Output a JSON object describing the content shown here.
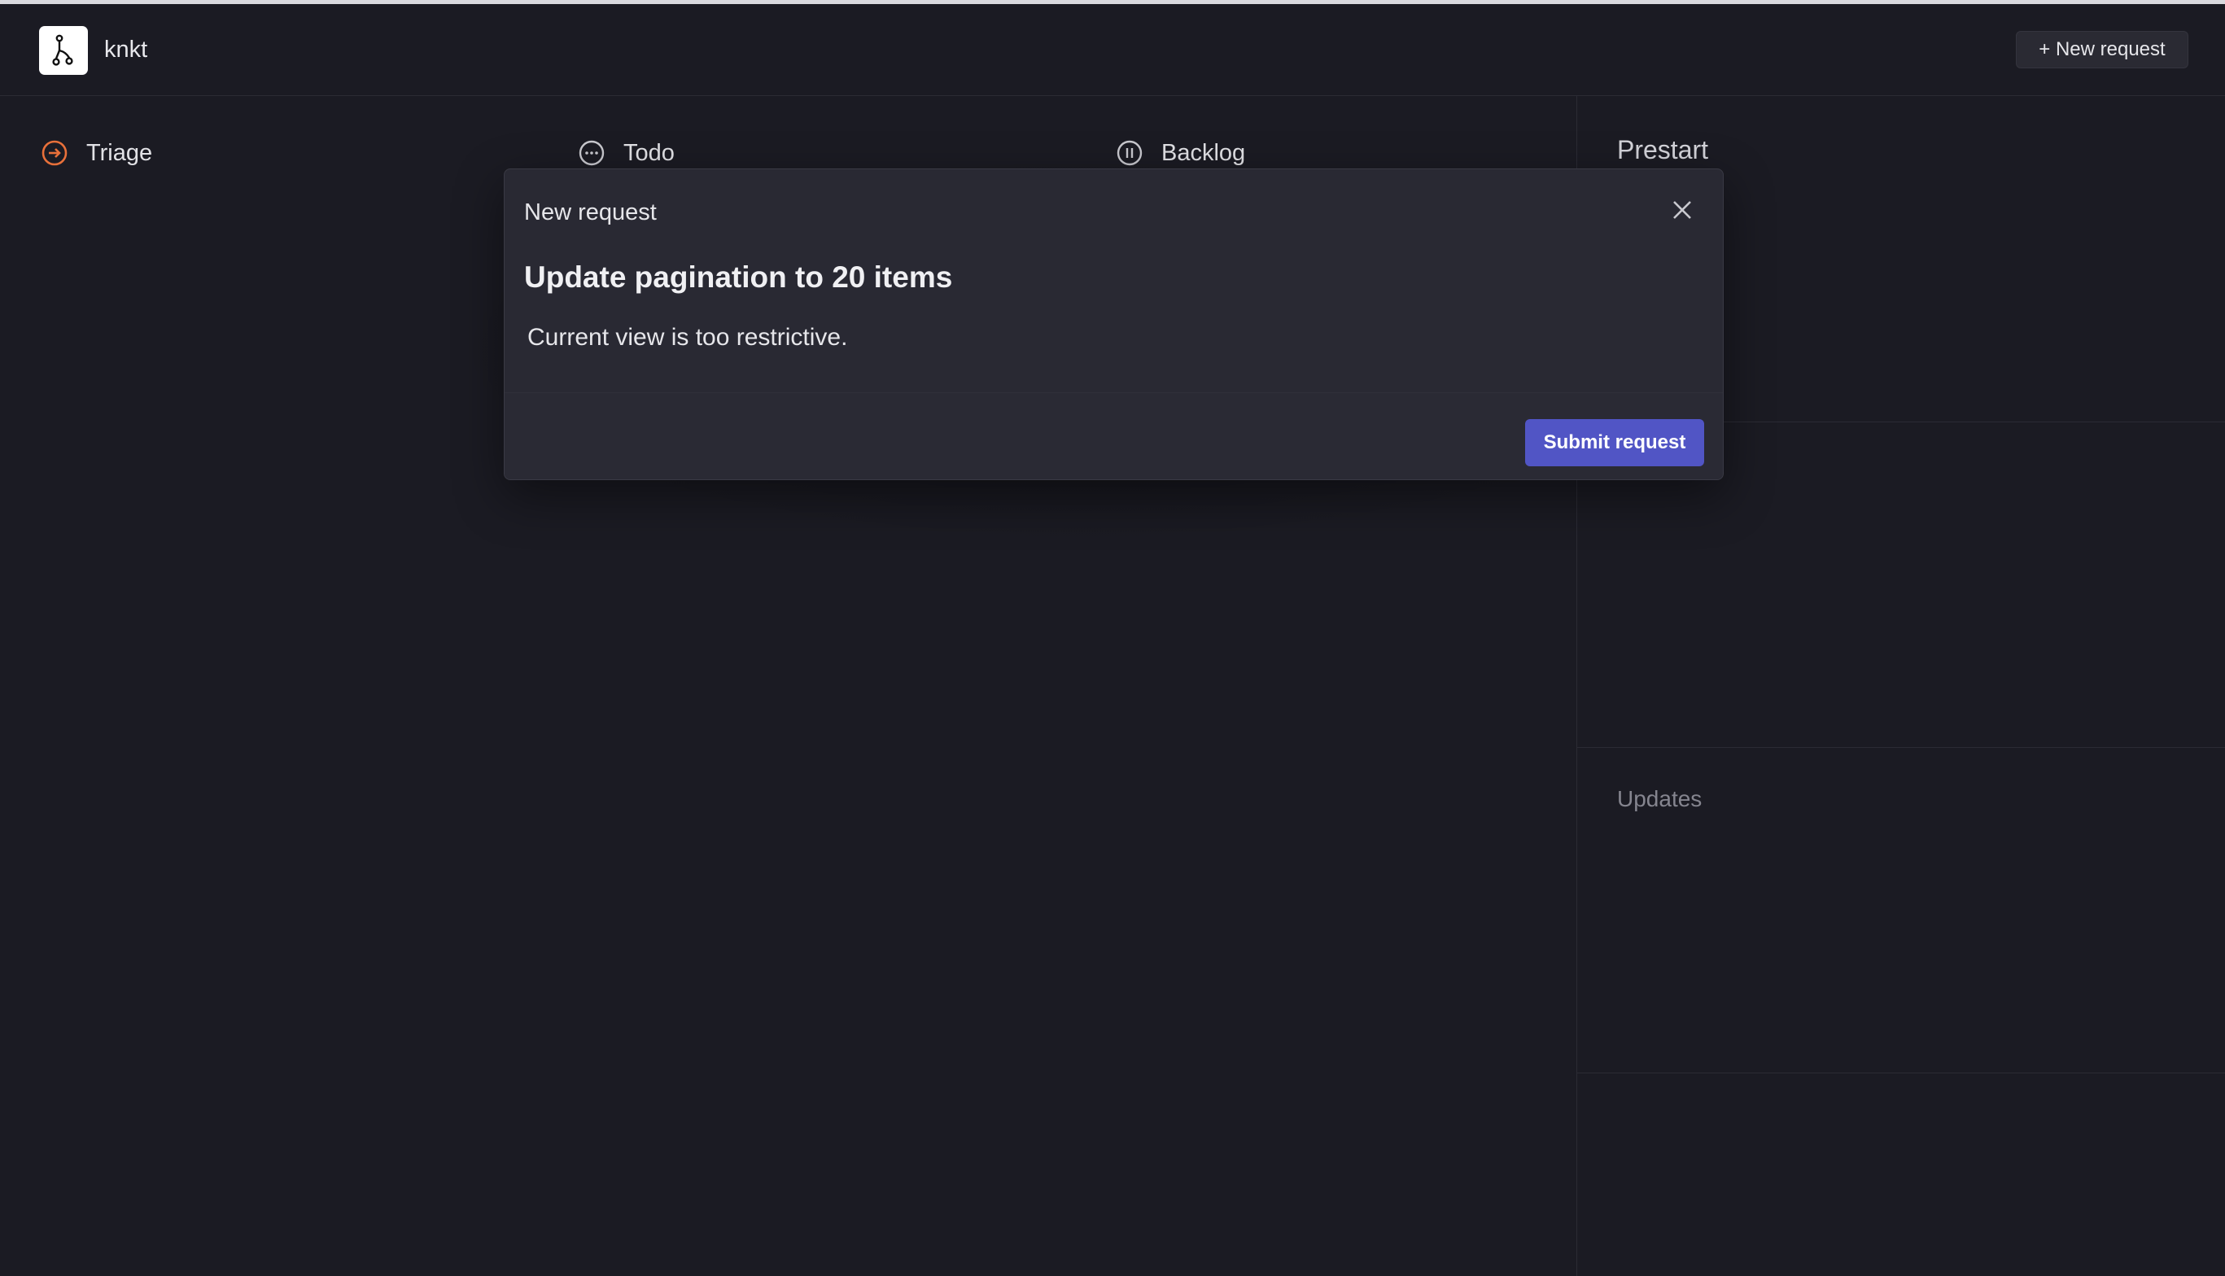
{
  "app": {
    "brand": "knkt",
    "new_request_button": "+ New request"
  },
  "columns": [
    {
      "label": "Triage",
      "icon": "triage-arrow-icon",
      "color": "#e8703a"
    },
    {
      "label": "Todo",
      "icon": "todo-dots-icon",
      "color": "#c9c9cf"
    },
    {
      "label": "Backlog",
      "icon": "backlog-pause-icon",
      "color": "#c9c9cf"
    }
  ],
  "right_panel": {
    "title": "Prestart",
    "updates_label": "Updates"
  },
  "modal": {
    "title": "New request",
    "heading": "Update pagination to 20 items",
    "body": "Current view is too restrictive.",
    "submit_label": "Submit request"
  },
  "colors": {
    "background": "#1b1b23",
    "accent": "#5155c5",
    "triage": "#e8703a"
  }
}
